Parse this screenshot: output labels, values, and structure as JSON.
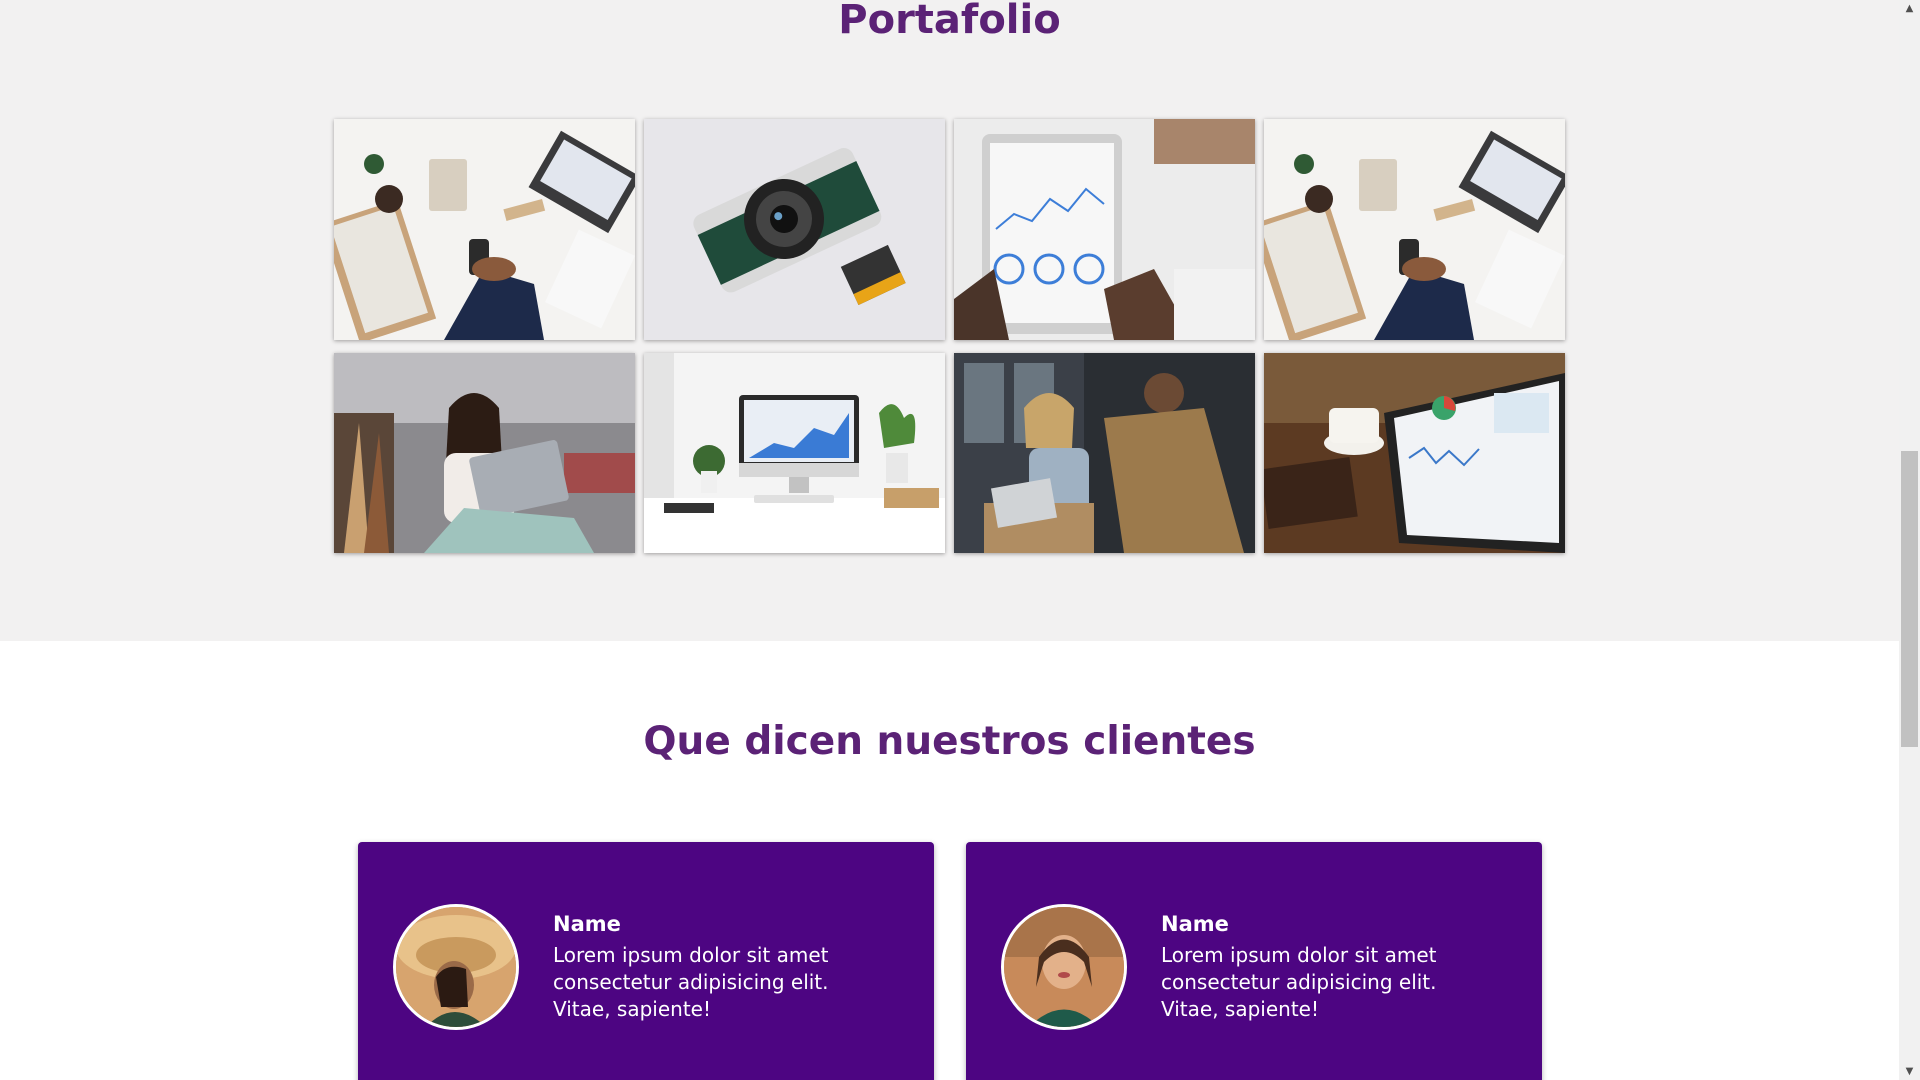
{
  "portfolio": {
    "title": "Portafolio",
    "images": [
      {
        "name": "business-desk-photo"
      },
      {
        "name": "camera-film-photo"
      },
      {
        "name": "tablet-analytics-photo"
      },
      {
        "name": "business-desk-photo-2"
      },
      {
        "name": "woman-laptop-photo"
      },
      {
        "name": "imac-workspace-photo"
      },
      {
        "name": "team-discussion-photo"
      },
      {
        "name": "tablet-dashboard-photo"
      }
    ]
  },
  "testimonials": {
    "title": "Que dicen nuestros clientes",
    "cards": [
      {
        "name": "Name",
        "text": "Lorem ipsum dolor sit amet consectetur adipisicing elit. Vitae, sapiente!"
      },
      {
        "name": "Name",
        "text": "Lorem ipsum dolor sit amet consectetur adipisicing elit. Vitae, sapiente!"
      }
    ]
  },
  "colors": {
    "heading": "#5b2276",
    "card_bg": "#4d0582",
    "section_bg": "#f2f1f1"
  },
  "scrollbar": {
    "up_icon": "triangle-up-icon",
    "down_icon": "triangle-down-icon"
  }
}
